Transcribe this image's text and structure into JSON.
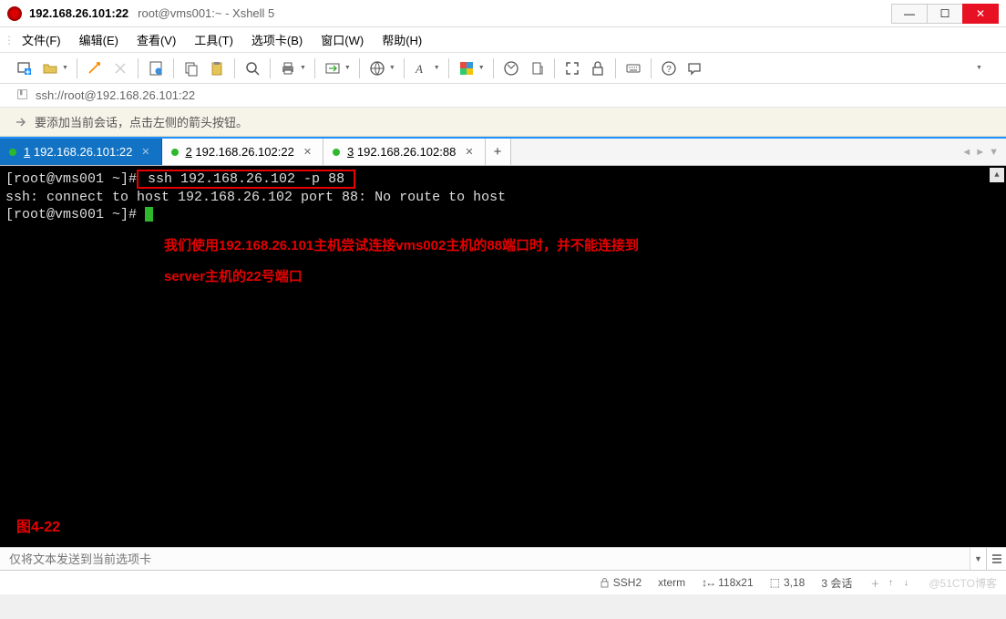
{
  "title": {
    "addr": "192.168.26.101:22",
    "rest": "root@vms001:~ - Xshell 5"
  },
  "menu": {
    "file": "文件(F)",
    "edit": "编辑(E)",
    "view": "查看(V)",
    "tools": "工具(T)",
    "tabs": "选项卡(B)",
    "window": "窗口(W)",
    "help": "帮助(H)"
  },
  "addrbar": {
    "url_icon": "🖻",
    "url": "ssh://root@192.168.26.101:22"
  },
  "hintbar": {
    "text": "要添加当前会话，点击左侧的箭头按钮。"
  },
  "tabs": [
    {
      "num": "1",
      "label": "192.168.26.101:22",
      "active": true
    },
    {
      "num": "2",
      "label": "192.168.26.102:22",
      "active": false
    },
    {
      "num": "3",
      "label": "192.168.26.102:88",
      "active": false
    }
  ],
  "terminal": {
    "line1_prompt": "[root@vms001 ~]#",
    "line1_cmd": " ssh 192.168.26.102 -p 88 ",
    "line2": "ssh: connect to host 192.168.26.102 port 88: No route to host",
    "line3_prompt": "[root@vms001 ~]# ",
    "annotation1": "我们使用192.168.26.101主机尝试连接vms002主机的88端口时，并不能连接到",
    "annotation2": "server主机的22号端口",
    "figure_label": "图4-22"
  },
  "sendbar": {
    "placeholder": "仅将文本发送到当前选项卡"
  },
  "status": {
    "proto": "SSH2",
    "term": "xterm",
    "size": "118x21",
    "pos": "3,18",
    "sessions": "3 会话",
    "watermark": "@51CTO博客"
  },
  "icons": {
    "minimize": "—",
    "maximize": "☐",
    "close": "✕",
    "bookmark": "🕮",
    "plus": "+"
  }
}
